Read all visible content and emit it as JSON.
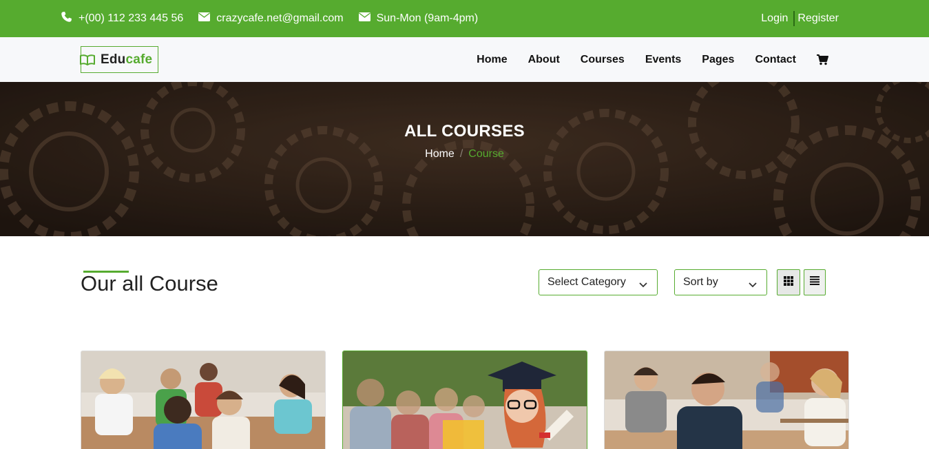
{
  "topbar": {
    "phone": "+(00) 112 233 445 56",
    "email": "crazycafe.net@gmail.com",
    "hours": "Sun-Mon (9am-4pm)",
    "login": "Login",
    "register": "Register"
  },
  "brand": {
    "part1": "Edu",
    "part2": "cafe"
  },
  "nav": {
    "items": [
      "Home",
      "About",
      "Courses",
      "Events",
      "Pages",
      "Contact"
    ]
  },
  "hero": {
    "title": "ALL COURSES",
    "breadcrumb_home": "Home",
    "breadcrumb_sep": "/",
    "breadcrumb_current": "Course"
  },
  "courses_section": {
    "title": "Our all Course",
    "category_select": "Select Category",
    "sort_select": "Sort by"
  },
  "colors": {
    "accent": "#56ab2f",
    "nav_bg": "#f7f8fa"
  },
  "icons": [
    "phone-icon",
    "envelope-icon",
    "envelope-icon",
    "book-icon",
    "cart-icon",
    "chevron-down-icon",
    "grid-view-icon",
    "list-view-icon"
  ]
}
